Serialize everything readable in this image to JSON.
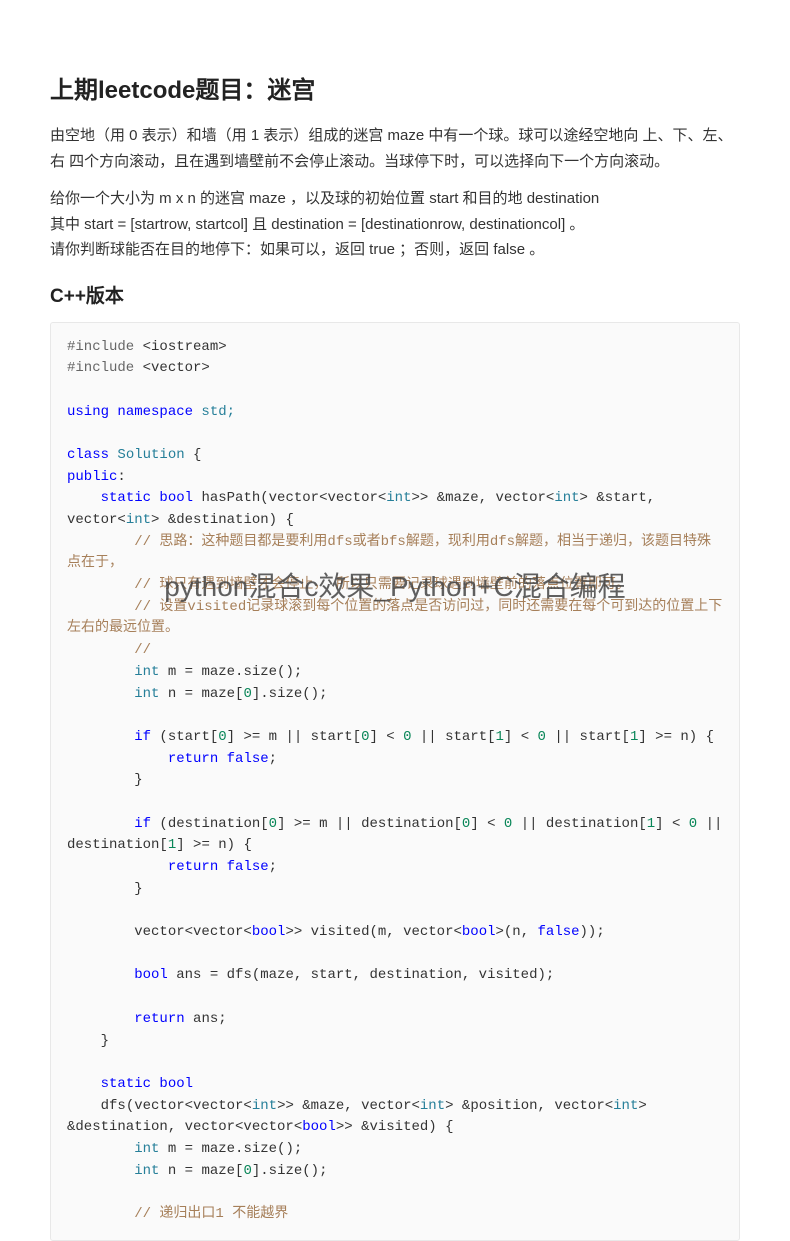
{
  "title": "上期leetcode题目：迷宫",
  "paragraph1": "由空地（用 0 表示）和墙（用 1 表示）组成的迷宫 maze 中有一个球。球可以途经空地向 上、下、左、右 四个方向滚动，且在遇到墙壁前不会停止滚动。当球停下时，可以选择向下一个方向滚动。",
  "paragraph2_l1": "给你一个大小为 m x n 的迷宫 maze ，以及球的初始位置 start 和目的地 destination",
  "paragraph2_l2": "其中 start = [startrow, startcol] 且 destination = [destinationrow, destinationcol] 。",
  "paragraph2_l3": "请你判断球能否在目的地停下：如果可以，返回 true ；否则，返回 false 。",
  "section_title": "C++版本",
  "watermark": "python混合c效果_Python+C混合编程",
  "code": {
    "l01a": "#include",
    "l01b": " <iostream>",
    "l02a": "#include",
    "l02b": " <vector>",
    "l04a": "using",
    "l04b": " namespace",
    "l04c": " std;",
    "l06a": "class",
    "l06b": " Solution",
    "l06c": " {",
    "l07a": "public",
    "l07b": ":",
    "l08a": "    static",
    "l08b": " bool",
    "l08c": " hasPath(vector<vector<",
    "l08d": "int",
    "l08e": ">> &maze, vector<",
    "l08f": "int",
    "l08g": "> &start, vector<",
    "l08h": "int",
    "l08i": "> &destination) {",
    "l09": "        // 思路：这种题目都是要利用dfs或者bfs解题，现利用dfs解题，相当于递归，该题目特殊点在于，",
    "l10": "        // 球只有遇到墙壁才会停止， 所以只需要记录球遇到墙壁前的落点位置即可。",
    "l11": "        // 设置visited记录球滚到每个位置的落点是否访问过，同时还需要在每个可到达的位置上下左右的最远位置。",
    "l12": "        //",
    "l13a": "        int",
    "l13b": " m = maze.size();",
    "l14a": "        int",
    "l14b": " n = maze[",
    "l14c": "0",
    "l14d": "].size();",
    "l16a": "        if",
    "l16b": " (start[",
    "l16c": "0",
    "l16d": "] >= m || start[",
    "l16e": "0",
    "l16f": "] < ",
    "l16g": "0",
    "l16h": " || start[",
    "l16i": "1",
    "l16j": "] < ",
    "l16k": "0",
    "l16l": " || start[",
    "l16m": "1",
    "l16n": "] >= n) {",
    "l17a": "            return",
    "l17b": " false",
    "l17c": ";",
    "l18": "        }",
    "l20a": "        if",
    "l20b": " (destination[",
    "l20c": "0",
    "l20d": "] >= m || destination[",
    "l20e": "0",
    "l20f": "] < ",
    "l20g": "0",
    "l20h": " || destination[",
    "l20i": "1",
    "l20j": "] < ",
    "l20k": "0",
    "l20l": " || destination[",
    "l20m": "1",
    "l20n": "] >= n) {",
    "l21a": "            return",
    "l21b": " false",
    "l21c": ";",
    "l22": "        }",
    "l24a": "        vector<vector<",
    "l24b": "bool",
    "l24c": ">> visited(m, vector<",
    "l24d": "bool",
    "l24e": ">(n, ",
    "l24f": "false",
    "l24g": "));",
    "l26a": "        bool",
    "l26b": " ans = dfs(maze, start, destination, visited);",
    "l28a": "        return",
    "l28b": " ans;",
    "l29": "    }",
    "l31a": "    static",
    "l31b": " bool",
    "l32a": "    dfs(vector<vector<",
    "l32b": "int",
    "l32c": ">> &maze, vector<",
    "l32d": "int",
    "l32e": "> &position, vector<",
    "l32f": "int",
    "l32g": "> &destination, vector<vector<",
    "l32h": "bool",
    "l32i": ">> &visited) {",
    "l33a": "        int",
    "l33b": " m = maze.size();",
    "l34a": "        int",
    "l34b": " n = maze[",
    "l34c": "0",
    "l34d": "].size();",
    "l36": "        // 递归出口1 不能越界"
  }
}
